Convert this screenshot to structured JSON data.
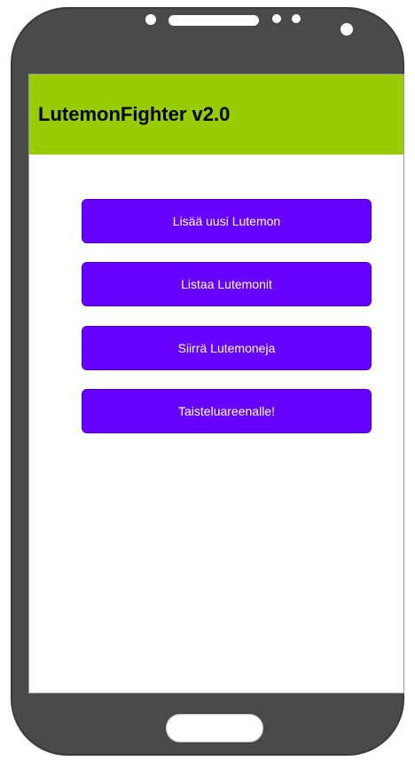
{
  "device": {
    "frame_color": "#4a4a4a",
    "icons": [
      "front-camera-icon",
      "speaker-grille-icon",
      "sensor-icon",
      "sensor-icon",
      "front-camera-icon"
    ]
  },
  "app_bar": {
    "title": "LutemonFighter v2.0",
    "background_color": "#99cc00"
  },
  "main": {
    "button_color": "#6600ff",
    "buttons": [
      {
        "label": "Lisää uusi Lutemon"
      },
      {
        "label": "Listaa Lutemonit"
      },
      {
        "label": "Siirrä Lutemoneja"
      },
      {
        "label": "Taisteluareenalle!"
      }
    ]
  }
}
